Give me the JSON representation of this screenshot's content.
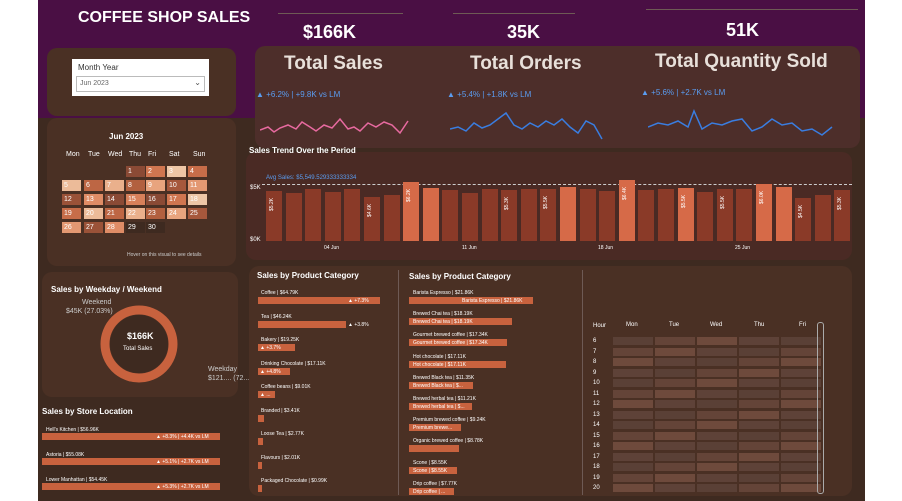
{
  "title": "COFFEE SHOP SALES",
  "kpis": [
    {
      "value": "$166K",
      "label": "Total Sales",
      "delta": "▲ +6.2% | +9.8K vs LM"
    },
    {
      "value": "35K",
      "label": "Total Orders",
      "delta": "▲ +5.4% | +1.8K vs LM"
    },
    {
      "value": "51K",
      "label": "Total Quantity Sold",
      "delta": "▲ +5.6% | +2.7K vs LM"
    }
  ],
  "filter": {
    "label": "Month Year",
    "value": "Jun 2023"
  },
  "calendar": {
    "title": "Jun 2023",
    "days": [
      "Mon",
      "Tue",
      "Wed",
      "Thu",
      "Fri",
      "Sat",
      "Sun"
    ],
    "dates": [
      "1",
      "2",
      "3",
      "4",
      "5",
      "6",
      "7",
      "8",
      "9",
      "10",
      "11",
      "12",
      "13",
      "14",
      "15",
      "16",
      "17",
      "18",
      "19",
      "20",
      "21",
      "22",
      "23",
      "24",
      "25",
      "26",
      "27",
      "28",
      "29",
      "30"
    ],
    "hint": "Hover on this visual to see details"
  },
  "trend": {
    "title": "Sales Trend Over the Period",
    "avg_label": "Avg Sales: $5,549.529333333334",
    "y_ticks": [
      "$5K",
      "$0K"
    ],
    "x_ticks": [
      "04 Jun",
      "11 Jun",
      "18 Jun",
      "25 Jun"
    ],
    "bar_labels": [
      "$5.2K",
      "$5.3K",
      "$4.6K",
      "$6.2K",
      "$5.3K",
      "$5.5K",
      "$6.4K",
      "$5.5K",
      "$5.5K",
      "$6.0K",
      "$4.5K",
      "$5.3K"
    ]
  },
  "weekday": {
    "title": "Sales by Weekday / Weekend",
    "weekend_label": "Weekend",
    "weekend_value": "$45K (27.03%)",
    "center_value": "$166K",
    "center_label": "Total Sales",
    "weekday_label": "Weekday",
    "weekday_value": "$121.... (72....)"
  },
  "store": {
    "title": "Sales by Store Location",
    "items": [
      {
        "name": "Hell's Kitchen | $56.96K",
        "tag": "▲ +8.3% | +4.4K vs LM"
      },
      {
        "name": "Astoria | $55.08K",
        "tag": "▲ +5.1% | +2.7K vs LM"
      },
      {
        "name": "Lower Manhattan | $54.45K",
        "tag": "▲ +5.3% | +2.7K vs LM"
      }
    ]
  },
  "category": {
    "title": "Sales by Product Category",
    "items": [
      {
        "name": "Coffee | $64.79K",
        "tag": "▲ +7.3%",
        "frac": 1.0
      },
      {
        "name": "Tea | $46.24K",
        "tag": "▲ +3.8%",
        "frac": 0.72
      },
      {
        "name": "Bakery | $19.25K",
        "tag": "▲ +3.7%",
        "frac": 0.3
      },
      {
        "name": "Drinking Chocolate | $17.11K",
        "tag": "▲ +4.8%",
        "frac": 0.26
      },
      {
        "name": "Coffee beans | $9.01K",
        "tag": "▲ ...",
        "frac": 0.14
      },
      {
        "name": "Branded | $3.41K",
        "tag": "",
        "frac": 0.05
      },
      {
        "name": "Loose Tea | $2.77K",
        "tag": "",
        "frac": 0.04
      },
      {
        "name": "Flavours | $2.01K",
        "tag": "",
        "frac": 0.03
      },
      {
        "name": "Packaged Chocolate | $0.99K",
        "tag": "",
        "frac": 0.02
      }
    ]
  },
  "type": {
    "title": "Sales by Product Category",
    "items": [
      {
        "name": "Barista Espresso | $21.86K",
        "tag": "Barista Espresso | $21.86K",
        "frac": 1.0
      },
      {
        "name": "Brewed Chai tea | $18.19K",
        "tag": "Brewed Chai tea | $18.19K",
        "frac": 0.83
      },
      {
        "name": "Gourmet brewed coffee | $17.34K",
        "tag": "Gourmet brewed coffee | $17.34K",
        "frac": 0.79
      },
      {
        "name": "Hot chocolate | $17.11K",
        "tag": "Hot chocolate | $17.11K",
        "frac": 0.78
      },
      {
        "name": "Brewed Black tea | $11.35K",
        "tag": "Brewed Black tea | $...",
        "frac": 0.52
      },
      {
        "name": "Brewed herbal tea | $11.21K",
        "tag": "Brewed herbal tea | $...",
        "frac": 0.51
      },
      {
        "name": "Premium brewed coffee | $9.24K",
        "tag": "Premium brewe...",
        "frac": 0.42
      },
      {
        "name": "Organic brewed coffee | $8.78K",
        "tag": "",
        "frac": 0.4
      },
      {
        "name": "Scone | $8.55K",
        "tag": "Scone | $8.55K",
        "frac": 0.39
      },
      {
        "name": "Drip coffee | $7.77K",
        "tag": "Drip coffee | ...",
        "frac": 0.36
      }
    ]
  },
  "heatmap": {
    "hour_label": "Hour",
    "days": [
      "Mon",
      "Tue",
      "Wed",
      "Thu",
      "Fri"
    ],
    "hours": [
      "6",
      "7",
      "8",
      "9",
      "10",
      "11",
      "12",
      "13",
      "14",
      "15",
      "16",
      "17",
      "18",
      "19",
      "20"
    ]
  },
  "colors": {
    "accent": "#c8623e",
    "kpi_blue": "#5a9cf0",
    "pink": "#e86aa0"
  }
}
